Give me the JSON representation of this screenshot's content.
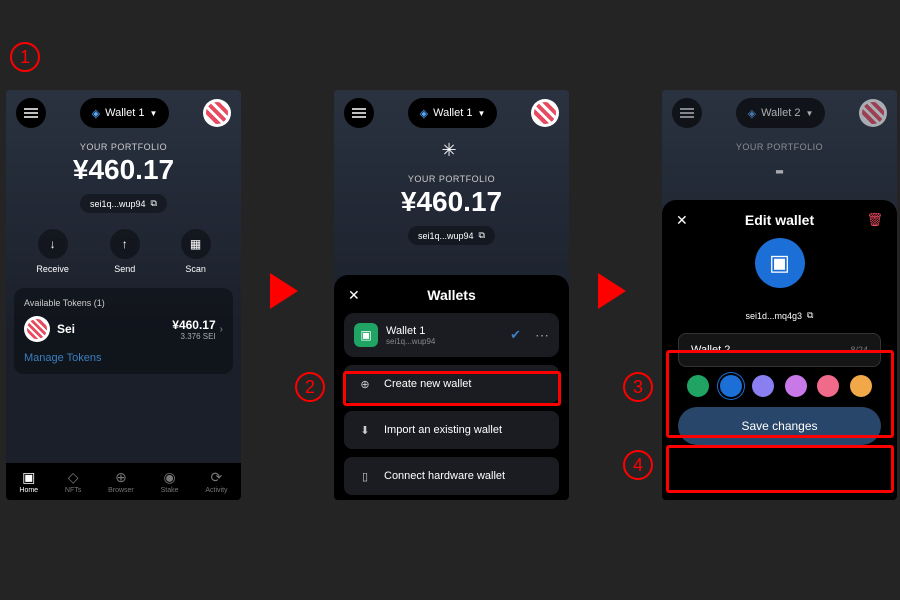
{
  "annotations": {
    "step1": "1",
    "step2": "2",
    "step3": "3",
    "step4": "4"
  },
  "phone1": {
    "wallet_selector": "Wallet 1",
    "portfolio_label": "YOUR PORTFOLIO",
    "portfolio_value": "¥460.17",
    "address": "sei1q...wup94",
    "actions": {
      "receive": "Receive",
      "send": "Send",
      "scan": "Scan"
    },
    "tokens_header": "Available Tokens (1)",
    "token": {
      "name": "Sei",
      "value": "¥460.17",
      "amount": "3.376 SEI"
    },
    "manage": "Manage Tokens",
    "nav": {
      "home": "Home",
      "nfts": "NFTs",
      "browser": "Browser",
      "stake": "Stake",
      "activity": "Activity"
    }
  },
  "phone2": {
    "wallet_selector": "Wallet 1",
    "portfolio_label": "YOUR PORTFOLIO",
    "portfolio_value": "¥460.17",
    "address": "sei1q...wup94",
    "sheet_title": "Wallets",
    "wallet_row": {
      "name": "Wallet 1",
      "addr": "sei1q...wup94"
    },
    "create": "Create new wallet",
    "import": "Import an existing wallet",
    "hardware": "Connect hardware wallet"
  },
  "phone3": {
    "wallet_selector": "Wallet 2",
    "portfolio_label": "YOUR PORTFOLIO",
    "portfolio_value": "-",
    "sheet_title": "Edit wallet",
    "address": "sei1d...mq4g3",
    "name_input": "Wallet 2",
    "name_count": "8/24",
    "colors": [
      "#20a464",
      "#1b6fd6",
      "#8a7ff0",
      "#c978e8",
      "#f06a8a",
      "#f0a848"
    ],
    "selected_color_index": 1,
    "save": "Save changes"
  }
}
